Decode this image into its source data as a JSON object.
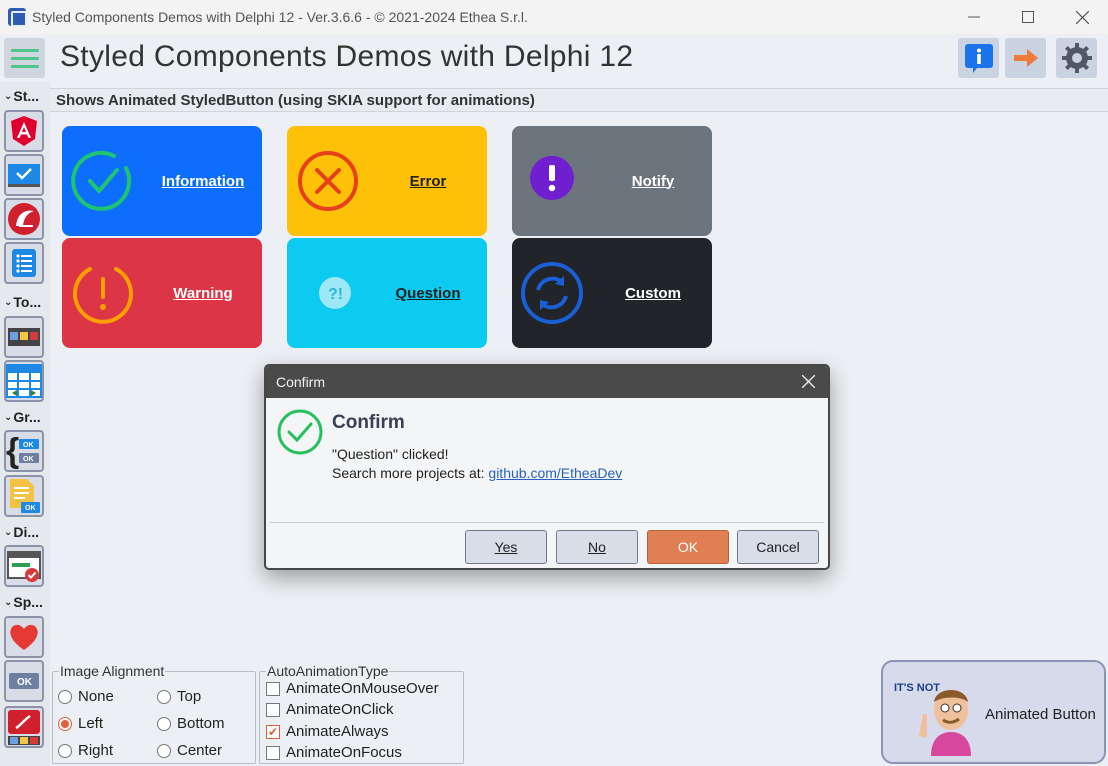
{
  "window": {
    "title": "Styled Components Demos with Delphi 12 - Ver.3.6.6 - © 2021-2024 Ethea S.r.l.",
    "controls": [
      "minimize",
      "maximize",
      "close"
    ]
  },
  "header": {
    "title": "Styled Components Demos with Delphi 12",
    "buttons": [
      "info-icon",
      "exit-arrow-icon",
      "gear-icon"
    ]
  },
  "sidebar": {
    "categories": [
      {
        "label": "St..."
      },
      {
        "label": "To..."
      },
      {
        "label": "Gr..."
      },
      {
        "label": "Di..."
      },
      {
        "label": "Sp..."
      }
    ],
    "items": [
      {
        "icon": "angular-icon"
      },
      {
        "icon": "checkbox-screen-icon"
      },
      {
        "icon": "delphi-helmet-icon"
      },
      {
        "icon": "list-icon"
      },
      {
        "icon": "toolbar-icon"
      },
      {
        "icon": "grid-icon"
      },
      {
        "icon": "buttons-group-icon"
      },
      {
        "icon": "document-ok-icon"
      },
      {
        "icon": "dialog-check-icon"
      },
      {
        "icon": "heart-icon"
      },
      {
        "icon": "ok-button-icon"
      },
      {
        "icon": "delphi-logo-icon"
      }
    ]
  },
  "description": "Shows Animated StyledButton (using SKIA support for animations)",
  "styled_buttons": [
    {
      "label": "Information",
      "color": "#0d6efd",
      "text_color": "#ffffff",
      "icon": "check-circle-icon"
    },
    {
      "label": "Error",
      "color": "#ffc107",
      "text_color": "#222222",
      "icon": "x-circle-icon"
    },
    {
      "label": "Notify",
      "color": "#6c757d",
      "text_color": "#ffffff",
      "icon": "exclamation-icon"
    },
    {
      "label": "Warning",
      "color": "#dc3545",
      "text_color": "#ffffff",
      "icon": "warning-circle-icon"
    },
    {
      "label": "Question",
      "color": "#0dcaf0",
      "text_color": "#222222",
      "icon": "question-icon"
    },
    {
      "label": "Custom",
      "color": "#212529",
      "text_color": "#ffffff",
      "icon": "refresh-icon"
    }
  ],
  "dialog": {
    "title": "Confirm",
    "heading": "Confirm",
    "message": "\"Question\" clicked!",
    "link_prefix": "Search more projects at: ",
    "link_text": "github.com/EtheaDev",
    "buttons": [
      {
        "label": "Yes",
        "default": false
      },
      {
        "label": "No",
        "default": false
      },
      {
        "label": "OK",
        "default": true
      },
      {
        "label": "Cancel",
        "default": false
      }
    ]
  },
  "image_alignment": {
    "title": "Image Alignment",
    "options": [
      {
        "label": "None",
        "selected": false
      },
      {
        "label": "Top",
        "selected": false
      },
      {
        "label": "Left",
        "selected": true
      },
      {
        "label": "Bottom",
        "selected": false
      },
      {
        "label": "Right",
        "selected": false
      },
      {
        "label": "Center",
        "selected": false
      }
    ]
  },
  "auto_animation": {
    "title": "AutoAnimationType",
    "options": [
      {
        "label": "AnimateOnMouseOver",
        "checked": false
      },
      {
        "label": "AnimateOnClick",
        "checked": false
      },
      {
        "label": "AnimateAlways",
        "checked": true
      },
      {
        "label": "AnimateOnFocus",
        "checked": false
      }
    ]
  },
  "animated_button": {
    "label": "Animated Button",
    "sticker_text": "IT'S NOT"
  },
  "colors": {
    "accent": "#e07f54",
    "info_blue": "#1a73e8",
    "exit_orange": "#f07a3a",
    "sidebar_hamburger": "#4cc58a"
  }
}
